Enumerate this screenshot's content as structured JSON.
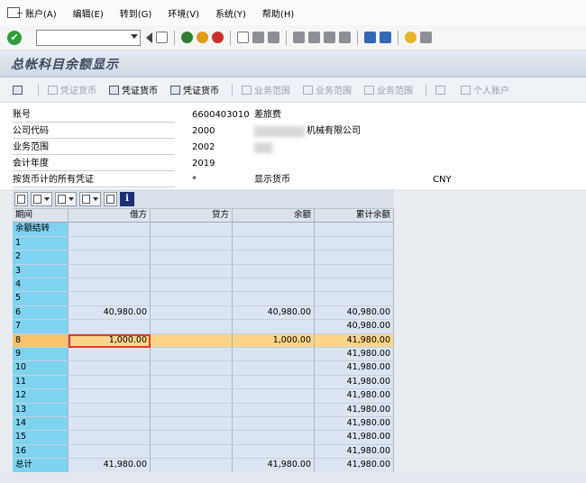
{
  "menu": [
    "账户(A)",
    "编辑(E)",
    "转到(G)",
    "环境(V)",
    "系统(Y)",
    "帮助(H)"
  ],
  "command_field": {
    "value": ""
  },
  "title": "总帐科目余额显示",
  "app_toolbar": [
    {
      "label": "凭证货币",
      "enabled": false
    },
    {
      "label": "凭证货币",
      "enabled": true
    },
    {
      "label": "凭证货币",
      "enabled": true
    },
    {
      "label": "业务范围",
      "enabled": false
    },
    {
      "label": "业务范围",
      "enabled": false
    },
    {
      "label": "业务范围",
      "enabled": false
    },
    {
      "label": "个人账户",
      "enabled": false
    }
  ],
  "header": {
    "account_label": "账号",
    "account_value": "6600403010",
    "account_text": "差旅费",
    "company_label": "公司代码",
    "company_value": "2000",
    "company_text": "机械有限公司",
    "business_area_label": "业务范围",
    "business_area_value": "2002",
    "fiscal_year_label": "会计年度",
    "fiscal_year_value": "2019",
    "currency_scope_label": "按货币计的所有凭证",
    "currency_scope_value": "*",
    "display_currency_label": "显示货币",
    "display_currency_value": "CNY"
  },
  "grid": {
    "columns": [
      "期间",
      "借方",
      "贷方",
      "余额",
      "累计余额"
    ],
    "rows": [
      [
        "余额结转",
        "",
        "",
        "",
        ""
      ],
      [
        "1",
        "",
        "",
        "",
        ""
      ],
      [
        "2",
        "",
        "",
        "",
        ""
      ],
      [
        "3",
        "",
        "",
        "",
        ""
      ],
      [
        "4",
        "",
        "",
        "",
        ""
      ],
      [
        "5",
        "",
        "",
        "",
        ""
      ],
      [
        "6",
        "40,980.00",
        "",
        "40,980.00",
        "40,980.00"
      ],
      [
        "7",
        "",
        "",
        "",
        "40,980.00"
      ],
      [
        "8",
        "1,000.00",
        "",
        "1,000.00",
        "41,980.00"
      ],
      [
        "9",
        "",
        "",
        "",
        "41,980.00"
      ],
      [
        "10",
        "",
        "",
        "",
        "41,980.00"
      ],
      [
        "11",
        "",
        "",
        "",
        "41,980.00"
      ],
      [
        "12",
        "",
        "",
        "",
        "41,980.00"
      ],
      [
        "13",
        "",
        "",
        "",
        "41,980.00"
      ],
      [
        "14",
        "",
        "",
        "",
        "41,980.00"
      ],
      [
        "15",
        "",
        "",
        "",
        "41,980.00"
      ],
      [
        "16",
        "",
        "",
        "",
        "41,980.00"
      ],
      [
        "总计",
        "41,980.00",
        "",
        "41,980.00",
        "41,980.00"
      ]
    ],
    "selected_row": 8
  },
  "colors": {
    "period_column": "#7fd3f0",
    "selected_row": "#fbd58a",
    "highlight_box": "#e23a2f"
  }
}
